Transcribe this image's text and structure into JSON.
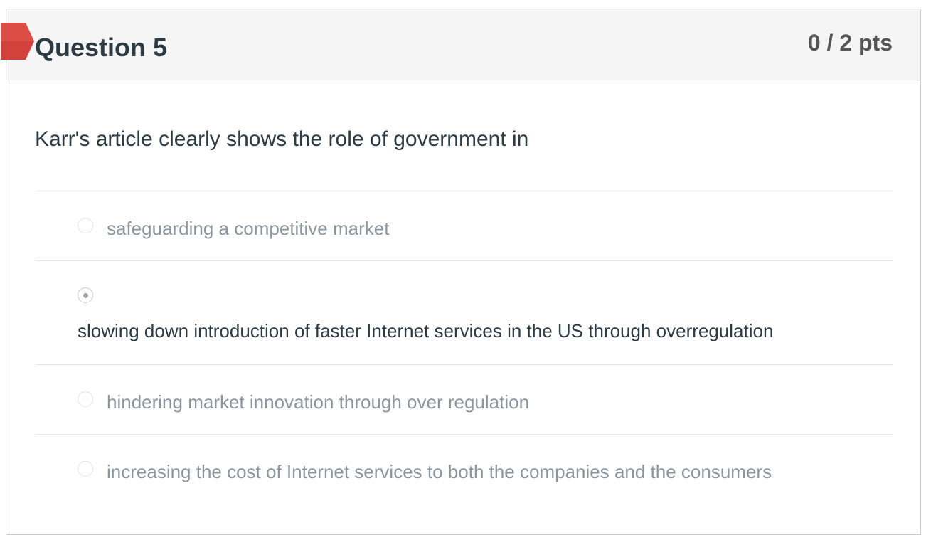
{
  "question": {
    "title": "Question 5",
    "points": "0 / 2 pts",
    "text": "Karr's article clearly shows the role of government in",
    "status_icon": "incorrect-flag-icon",
    "status_color": "#d2413b"
  },
  "answers": [
    {
      "label": "safeguarding a competitive market",
      "selected": false
    },
    {
      "label": "slowing down introduction of faster Internet services in the US through overregulation",
      "selected": true
    },
    {
      "label": "hindering market innovation through over regulation",
      "selected": false
    },
    {
      "label": "increasing the cost of Internet services to both the companies and the consumers",
      "selected": false
    }
  ]
}
